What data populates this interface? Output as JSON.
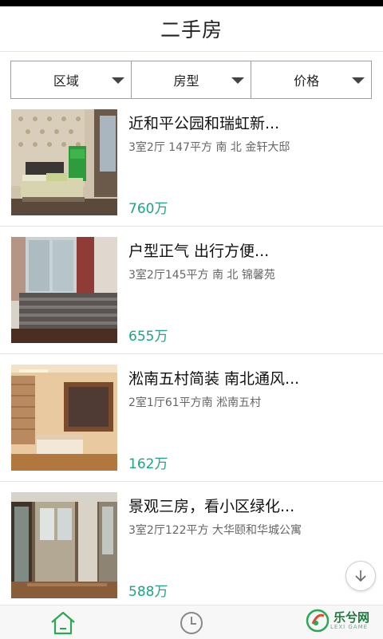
{
  "header": {
    "title": "二手房"
  },
  "filters": [
    {
      "label": "区域"
    },
    {
      "label": "房型"
    },
    {
      "label": "价格"
    }
  ],
  "listings": [
    {
      "title": "近和平公园和瑞虹新...",
      "meta": "3室2厅 147平方 南 北 金轩大邸",
      "price": "760万"
    },
    {
      "title": "户型正气 出行方便...",
      "meta": "3室2厅145平方 南 北 锦馨苑",
      "price": "655万"
    },
    {
      "title": "淞南五村简装 南北通风...",
      "meta": "2室1厅61平方南 淞南五村",
      "price": "162万"
    },
    {
      "title": "景观三房，看小区绿化...",
      "meta": "3室2厅122平方 大华颐和华城公寓",
      "price": "588万"
    }
  ],
  "tabs": [
    {
      "icon": "home-icon"
    },
    {
      "icon": "clock-icon"
    }
  ],
  "watermark": {
    "text": "乐兮网",
    "sub": "LEXI GAME"
  },
  "colors": {
    "accent": "#1aa586",
    "tab_active": "#2aa852"
  }
}
